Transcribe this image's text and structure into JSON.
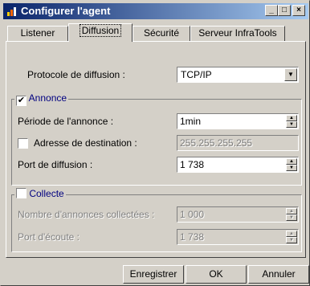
{
  "window": {
    "title": "Configurer l'agent",
    "controls": {
      "minimize": "_",
      "maximize": "□",
      "close": "×"
    }
  },
  "tabs": [
    {
      "label": "Listener",
      "active": false
    },
    {
      "label": "Diffusion",
      "active": true
    },
    {
      "label": "Sécurité",
      "active": false
    },
    {
      "label": "Serveur InfraTools",
      "active": false
    }
  ],
  "protocol": {
    "label": "Protocole de diffusion :",
    "value": "TCP/IP"
  },
  "annonce": {
    "title": "Annonce",
    "checked": true,
    "period": {
      "label": "Période de l'annonce :",
      "value": "1min"
    },
    "destination": {
      "label": "Adresse de destination :",
      "value": "255.255.255.255",
      "checked": false
    },
    "port": {
      "label": "Port de diffusion :",
      "value": "1 738"
    }
  },
  "collecte": {
    "title": "Collecte",
    "checked": false,
    "count": {
      "label": "Nombre d'annonces collectées :",
      "value": "1 000"
    },
    "port": {
      "label": "Port d'écoute :",
      "value": "1 738"
    }
  },
  "buttons": {
    "save": "Enregistrer",
    "ok": "OK",
    "cancel": "Annuler"
  },
  "icons": {
    "dropdown": "▼",
    "spin_up": "▲",
    "spin_down": "▼",
    "check": "✔"
  }
}
